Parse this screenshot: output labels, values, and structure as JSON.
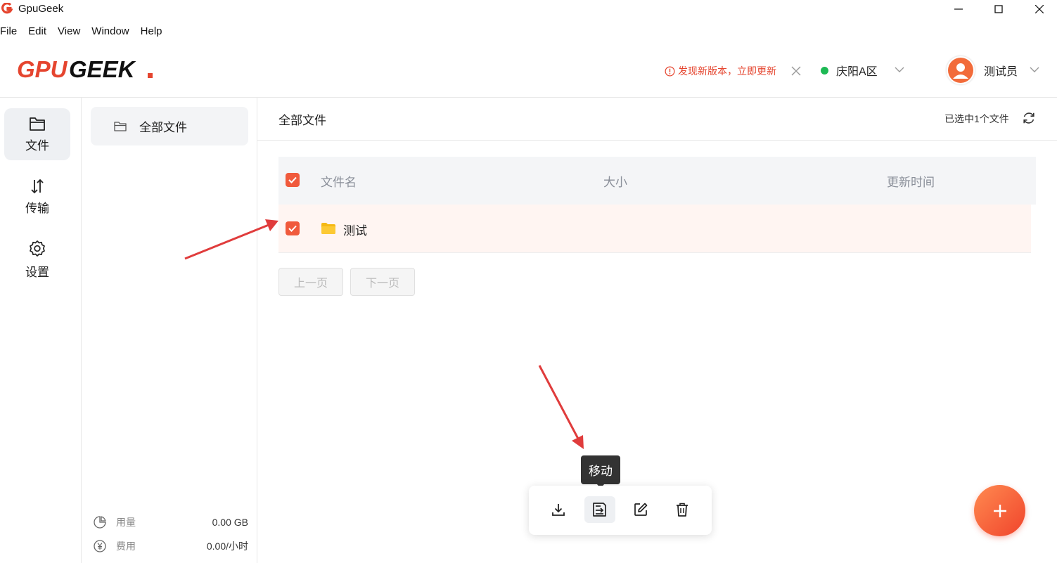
{
  "window": {
    "title": "GpuGeek"
  },
  "menu": {
    "items": [
      "File",
      "Edit",
      "View",
      "Window",
      "Help"
    ]
  },
  "header": {
    "update_notice": "发现新版本，立即更新",
    "region": "庆阳A区",
    "user_name": "测试员"
  },
  "nav": {
    "files_label": "文件",
    "transfer_label": "传输",
    "settings_label": "设置"
  },
  "folders": {
    "root_label": "全部文件"
  },
  "usage": {
    "storage_label": "用量",
    "storage_value": "0.00 GB",
    "cost_label": "费用",
    "cost_value": "0.00/小时"
  },
  "main": {
    "title": "全部文件",
    "selected_info": "已选中1个文件"
  },
  "table": {
    "columns": [
      "文件名",
      "大小",
      "更新时间"
    ],
    "rows": [
      {
        "name": "测试",
        "size": "",
        "updated": "",
        "checked": true
      }
    ]
  },
  "pager": {
    "prev_label": "上一页",
    "next_label": "下一页"
  },
  "toolbar": {
    "tooltip": "移动"
  },
  "colors": {
    "accent": "#f05a3c",
    "region_dot": "#1db954",
    "update_text": "#e5452f"
  }
}
